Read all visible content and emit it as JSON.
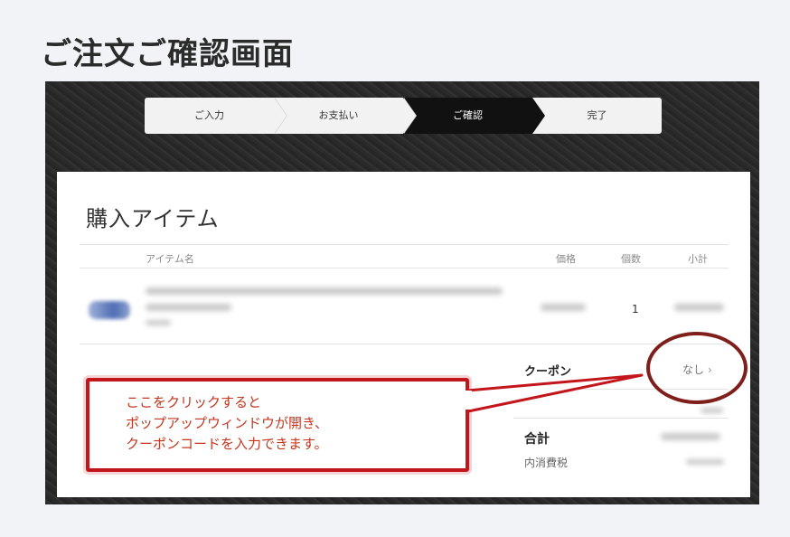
{
  "page": {
    "title": "ご注文ご確認画面"
  },
  "steps": [
    {
      "label": "ご入力",
      "active": false
    },
    {
      "label": "お支払い",
      "active": false
    },
    {
      "label": "ご確認",
      "active": true
    },
    {
      "label": "完了",
      "active": false
    }
  ],
  "card": {
    "title": "購入アイテム",
    "columns": {
      "item_name": "アイテム名",
      "price": "価格",
      "quantity": "個数",
      "subtotal": "小計"
    },
    "item": {
      "quantity": "1"
    },
    "coupon": {
      "label": "クーポン",
      "value": "なし",
      "arrow": "›"
    },
    "total": {
      "label": "合計",
      "tax_label": "内消費税"
    }
  },
  "annotation": {
    "lines": [
      "ここをクリックすると",
      "ポップアップウィンドウが開き、",
      "クーポンコードを入力できます。"
    ],
    "color": "#c4361f",
    "border_color": "#c3151c"
  }
}
